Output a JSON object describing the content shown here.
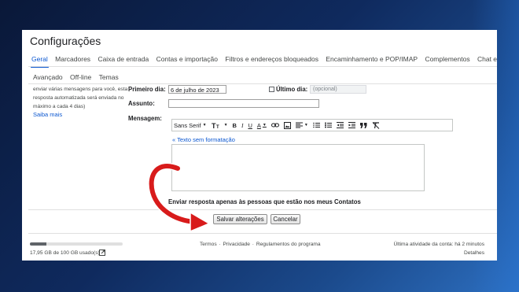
{
  "app": {
    "title": "Configurações"
  },
  "tabs": [
    {
      "label": "Geral",
      "active": true
    },
    {
      "label": "Marcadores"
    },
    {
      "label": "Caixa de entrada"
    },
    {
      "label": "Contas e importação"
    },
    {
      "label": "Filtros e endereços bloqueados"
    },
    {
      "label": "Encaminhamento e POP/IMAP"
    },
    {
      "label": "Complementos"
    },
    {
      "label": "Chat e Meet"
    }
  ],
  "tabs_row2": [
    {
      "label": "Avançado"
    },
    {
      "label": "Off-line"
    },
    {
      "label": "Temas"
    }
  ],
  "left_note": {
    "text": "enviar várias mensagens para você, esta resposta automatizada será enviada no máximo a cada 4 dias)",
    "link": "Saiba mais"
  },
  "form": {
    "first_day_label": "Primeiro dia:",
    "first_day_value": "6 de julho de 2023",
    "last_day_label": "Último dia:",
    "last_day_placeholder": "(opcional)",
    "subject_label": "Assunto:",
    "subject_value": "",
    "message_label": "Mensagem:",
    "plain_text_link": "« Texto sem formatação",
    "contacts_only_label": "Enviar resposta apenas às pessoas que estão nos meus Contatos"
  },
  "toolbar": {
    "font_name": "Sans Serif",
    "size_icon": "text-size-icon",
    "bold": "B",
    "italic": "I",
    "underline": "U",
    "text_color": "A"
  },
  "buttons": {
    "save": "Salvar alterações",
    "cancel": "Cancelar"
  },
  "footer": {
    "storage_text": "17,95 GB de 100 GB usado(s)",
    "storage_fraction": 0.18,
    "terms": "Termos",
    "privacy": "Privacidade",
    "policies": "Regulamentos do programa",
    "last_activity": "Última atividade da conta: há 2 minutos",
    "details": "Detalhes"
  },
  "colors": {
    "accent": "#0b57d0",
    "arrow": "#d81b1b"
  }
}
